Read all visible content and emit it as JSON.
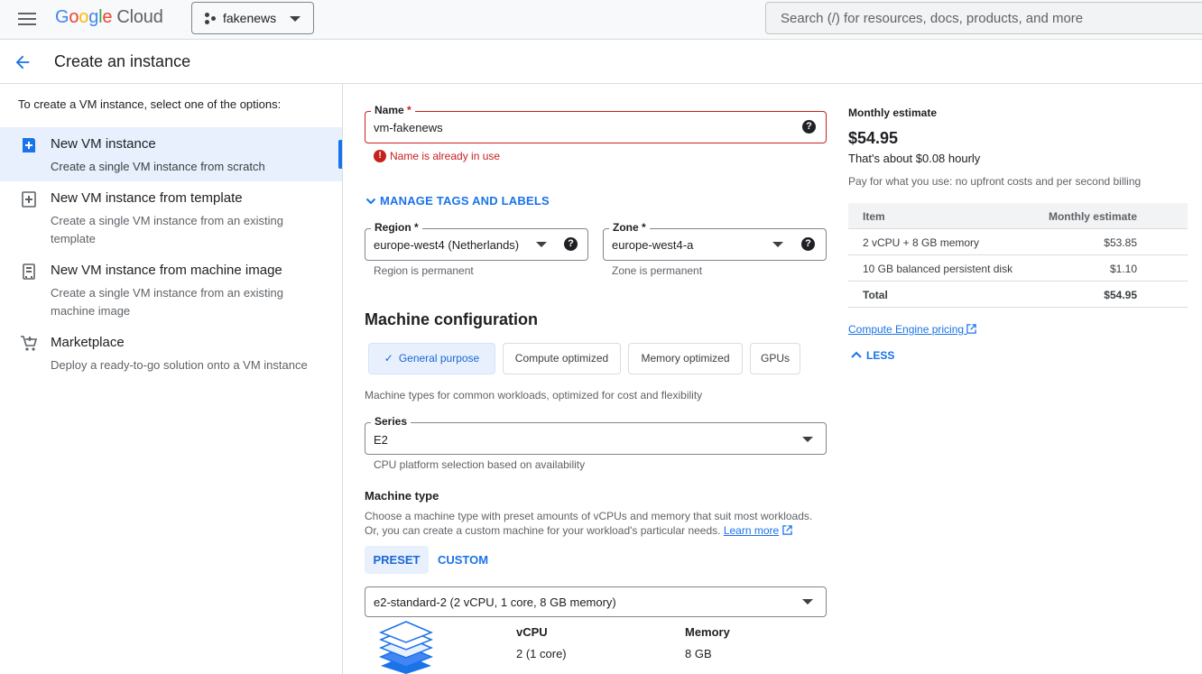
{
  "topbar": {
    "logo_google": [
      "G",
      "o",
      "o",
      "g",
      "l",
      "e"
    ],
    "logo_cloud": "Cloud",
    "project": "fakenews",
    "search_placeholder": "Search (/) for resources, docs, products, and more"
  },
  "page": {
    "title": "Create an instance"
  },
  "left": {
    "intro": "To create a VM instance, select one of the options:",
    "options": [
      {
        "title": "New VM instance",
        "desc": "Create a single VM instance from scratch",
        "icon": "add-box-icon",
        "selected": true
      },
      {
        "title": "New VM instance from template",
        "desc": "Create a single VM instance from an existing template",
        "icon": "template-icon",
        "selected": false
      },
      {
        "title": "New VM instance from machine image",
        "desc": "Create a single VM instance from an existing machine image",
        "icon": "machine-image-icon",
        "selected": false
      },
      {
        "title": "Marketplace",
        "desc": "Deploy a ready-to-go solution onto a VM instance",
        "icon": "cart-icon",
        "selected": false
      }
    ]
  },
  "form": {
    "name_label": "Name",
    "name_required": "*",
    "name_value": "vm-fakenews",
    "name_error": "Name is already in use",
    "manage_tags": "MANAGE TAGS AND LABELS",
    "region_label": "Region *",
    "region_value": "europe-west4 (Netherlands)",
    "region_hint": "Region is permanent",
    "zone_label": "Zone *",
    "zone_value": "europe-west4-a",
    "zone_hint": "Zone is permanent",
    "machine_config_title": "Machine configuration",
    "families": [
      "General purpose",
      "Compute optimized",
      "Memory optimized",
      "GPUs"
    ],
    "family_desc": "Machine types for common workloads, optimized for cost and flexibility",
    "series_label": "Series",
    "series_value": "E2",
    "series_hint": "CPU platform selection based on availability",
    "machine_type_title": "Machine type",
    "machine_type_desc1": "Choose a machine type with preset amounts of vCPUs and memory that suit most workloads.",
    "machine_type_desc2": "Or, you can create a custom machine for your workload's particular needs.",
    "learn_more": "Learn more",
    "tabs": [
      "PRESET",
      "CUSTOM"
    ],
    "machine_value": "e2-standard-2 (2 vCPU, 1 core, 8 GB memory)",
    "vcpu_label": "vCPU",
    "vcpu_value": "2 (1 core)",
    "memory_label": "Memory",
    "memory_value": "8 GB"
  },
  "estimate": {
    "title": "Monthly estimate",
    "price": "$54.95",
    "hourly": "That's about $0.08 hourly",
    "note": "Pay for what you use: no upfront costs and per second billing",
    "col_item": "Item",
    "col_estimate": "Monthly estimate",
    "rows": [
      {
        "item": "2 vCPU + 8 GB memory",
        "cost": "$53.85"
      },
      {
        "item": "10 GB balanced persistent disk",
        "cost": "$1.10"
      }
    ],
    "total_label": "Total",
    "total_value": "$54.95",
    "pricing_link": "Compute Engine pricing",
    "less": "LESS"
  },
  "colors": {
    "accent": "#1a73e8",
    "error": "#c5221f",
    "selected_bg": "#e8f0fe"
  }
}
